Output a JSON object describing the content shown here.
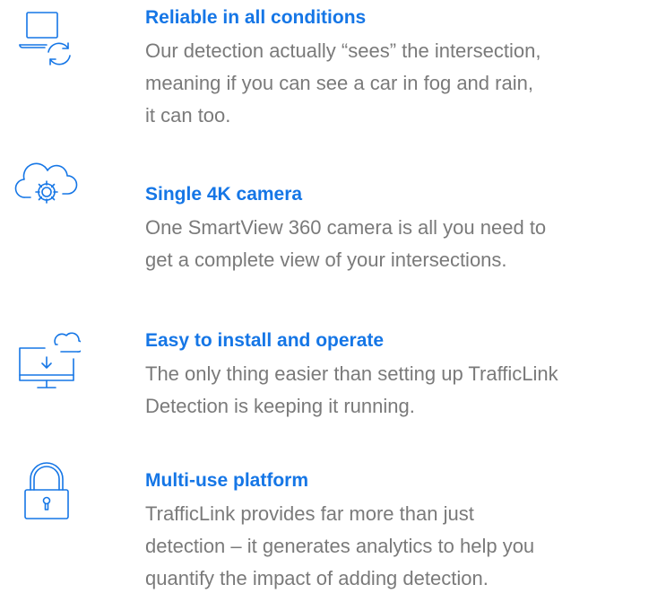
{
  "features": [
    {
      "icon": "laptop-sync-icon",
      "title": "Reliable in all conditions",
      "lines": [
        "Our detection actually “sees” the intersection,",
        "meaning if you can see a car in fog and rain,",
        "it can too."
      ]
    },
    {
      "icon": "cloud-gear-icon",
      "title": "Single 4K camera",
      "lines": [
        "One SmartView 360 camera is all you need to",
        "get a complete view of your intersections."
      ]
    },
    {
      "icon": "cloud-download-monitor-icon",
      "title": "Easy to install and operate",
      "lines": [
        "The only thing easier than setting up TrafficLink",
        "Detection is keeping it running."
      ]
    },
    {
      "icon": "padlock-icon",
      "title": "Multi-use platform",
      "lines": [
        "TrafficLink provides far more than just",
        "detection – it generates analytics to help you",
        "quantify the impact of adding detection."
      ]
    }
  ],
  "colors": {
    "accent": "#1576e6",
    "body_text": "#7a7a7a",
    "icon_stroke": "#1576e6"
  }
}
